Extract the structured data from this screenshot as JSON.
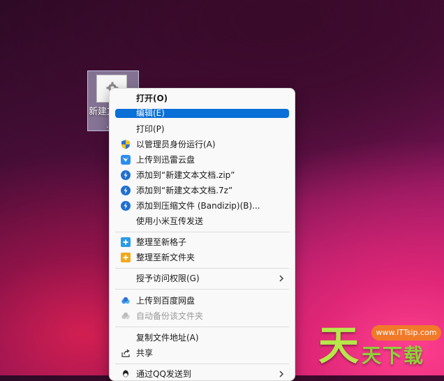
{
  "desktop_icon": {
    "label_line1": "新建文",
    "label_line2": ".t"
  },
  "context_menu": {
    "items": [
      {
        "label": "打开(O)",
        "icon": "none",
        "bold": true
      },
      {
        "label": "编辑(E)",
        "icon": "none",
        "highlighted": true
      },
      {
        "label": "打印(P)",
        "icon": "none"
      },
      {
        "label": "以管理员身份运行(A)",
        "icon": "shield-icon"
      },
      {
        "label": "上传到迅雷云盘",
        "icon": "xunlei-icon"
      },
      {
        "label": "添加到“新建文本文档.zip”",
        "icon": "bandizip-icon"
      },
      {
        "label": "添加到“新建文本文档.7z”",
        "icon": "bandizip-icon"
      },
      {
        "label": "添加到压缩文件 (Bandizip)(B)...",
        "icon": "bandizip-icon"
      },
      {
        "label": "使用小米互传发送",
        "icon": "none"
      },
      {
        "label": "整理至新格子",
        "icon": "fences-blue-icon"
      },
      {
        "label": "整理至新文件夹",
        "icon": "fences-yellow-icon"
      },
      {
        "label": "授予访问权限(G)",
        "icon": "none",
        "submenu": true
      },
      {
        "label": "上传到百度网盘",
        "icon": "baidu-netdisk-icon"
      },
      {
        "label": "自动备份该文件夹",
        "icon": "baidu-netdisk-gray-icon",
        "disabled": true
      },
      {
        "label": "复制文件地址(A)",
        "icon": "none"
      },
      {
        "label": "共享",
        "icon": "share-icon"
      },
      {
        "label": "通过QQ发送到",
        "icon": "qq-icon",
        "submenu": true
      }
    ]
  },
  "watermark": {
    "badge_text": "www.ITTsip.com",
    "big_char": "天",
    "small_text": "天下载"
  },
  "colors": {
    "highlight": "#0a6fd6",
    "menu_bg": "#f9f9f9"
  }
}
